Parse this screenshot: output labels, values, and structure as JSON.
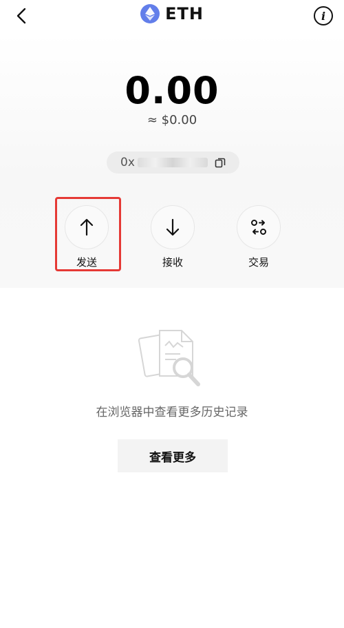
{
  "header": {
    "title": "ETH",
    "back_icon": "chevron-left-icon",
    "info_label": "i",
    "token_icon": "ethereum-icon",
    "token_color": "#627EEA"
  },
  "wallet": {
    "balance": "0.00",
    "fiat_value": "≈ $0.00",
    "address_prefix": "0x",
    "address_masked": true,
    "copy_icon": "copy-icon"
  },
  "actions": [
    {
      "label": "发送",
      "icon": "arrow-up-icon",
      "highlighted": true
    },
    {
      "label": "接收",
      "icon": "arrow-down-icon",
      "highlighted": false
    },
    {
      "label": "交易",
      "icon": "swap-icon",
      "highlighted": false
    }
  ],
  "highlight_color": "#E53935",
  "empty_state": {
    "illustration": "document-search-icon",
    "message": "在浏览器中查看更多历史记录",
    "button_label": "查看更多"
  }
}
